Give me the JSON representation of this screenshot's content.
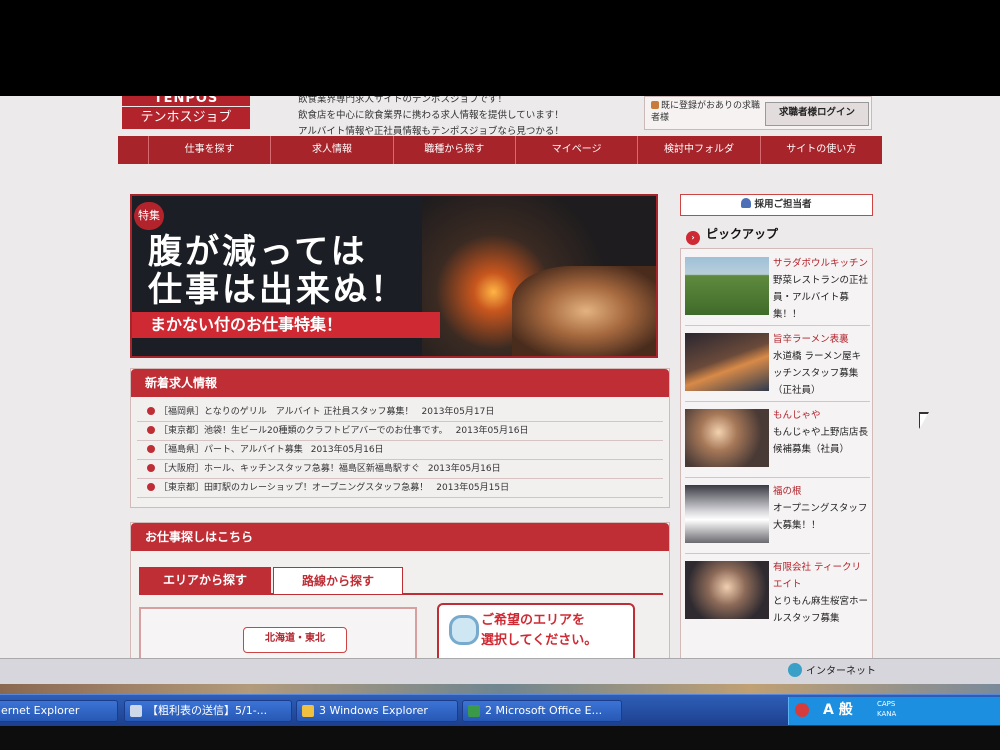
{
  "header": {
    "logo_top": "TENPOS",
    "logo_bottom": "テンホスジョブ",
    "intro_lines": [
      "飲食業界専門求人サイトのテンポスジョブです！",
      "飲食店を中心に飲食業界に携わる求人情報を提供しています！",
      "アルバイト情報や正社員情報もテンポスジョブなら見つかる！"
    ],
    "login_text": "既に登録がおありの求職者様",
    "login_button": "求職者様ログイン"
  },
  "nav": {
    "items": [
      "仕事を探す",
      "求人情報",
      "職種から探す",
      "マイページ",
      "検討中フォルダ",
      "サイトの使い方"
    ]
  },
  "banner": {
    "badge": "特集",
    "line1": "腹が減っては",
    "line2": "仕事は出来ぬ！",
    "strip": "まかない付のお仕事特集！"
  },
  "news": {
    "heading": "新着求人情報",
    "items": [
      {
        "text": "［福岡県］となりのゲリル　アルバイト 正社員スタッフ募集！",
        "date": "2013年05月17日"
      },
      {
        "text": "［東京都］池袋！生ビール20種類のクラフトビアバーでのお仕事です。",
        "date": "2013年05月16日"
      },
      {
        "text": "［福島県］パート、アルバイト募集",
        "date": "2013年05月16日"
      },
      {
        "text": "［大阪府］ホール、キッチンスタッフ急募！福島区新福島駅すぐ",
        "date": "2013年05月16日"
      },
      {
        "text": "［東京都］田町駅のカレーショップ！オープニングスタッフ急募！",
        "date": "2013年05月15日"
      }
    ]
  },
  "search": {
    "heading": "お仕事探しはこちら",
    "tab_area": "エリアから探す",
    "tab_line": "路線から探す",
    "area_button": "北海道・東北",
    "select_line1": "ご希望のエリアを",
    "select_line2": "選択してください。"
  },
  "sidebar": {
    "adopt": "採用ご担当者",
    "pickup_title": "ピックアップ",
    "items": [
      {
        "title": "サラダボウルキッチン",
        "desc": "野菜レストランの正社員・アルバイト募集！！"
      },
      {
        "title": "旨辛ラーメン表裏",
        "desc": "水道橋 ラーメン屋キッチンスタッフ募集（正社員）"
      },
      {
        "title": "もんじゃや",
        "desc": "もんじゃや上野店店長候補募集（社員）"
      },
      {
        "title": "福の根",
        "desc": "オープニングスタッフ大募集！！"
      },
      {
        "title": "有限会社 ティークリエイト",
        "desc": "とりもん麻生桜宮ホールスタッフ募集"
      }
    ]
  },
  "statusbar": {
    "zone": "インターネット"
  },
  "taskbar": {
    "ie": "ernet Explorer",
    "task1": "【粗利表の送信】5/1-...",
    "task2": "3 Windows Explorer",
    "task3": "2 Microsoft Office E...",
    "ime": "A 般",
    "caps": "CAPS",
    "kana": "KANA"
  }
}
